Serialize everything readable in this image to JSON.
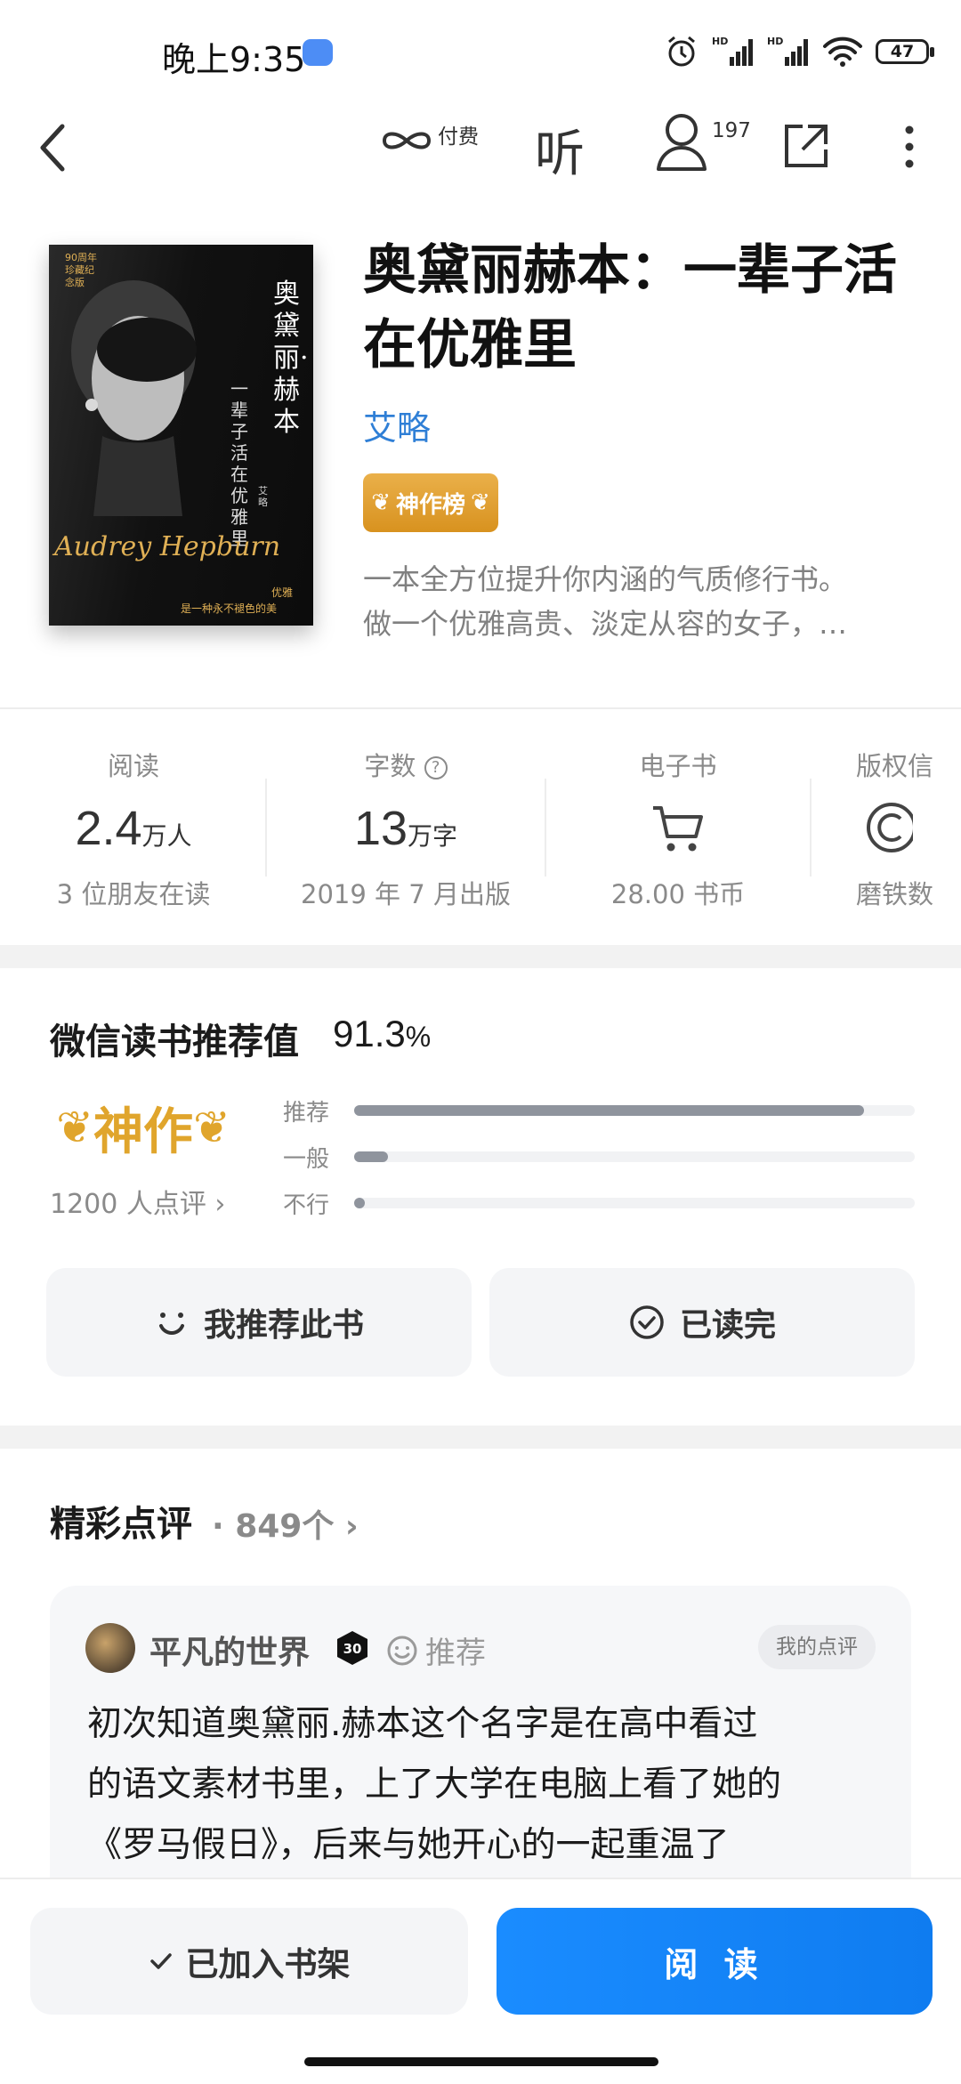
{
  "status": {
    "time": "晚上9:35",
    "battery": "47"
  },
  "topbar": {
    "paid_label": "付费",
    "listen_label": "听",
    "user_count": "197"
  },
  "book": {
    "title": "奥黛丽赫本：一辈子活在优雅里",
    "author": "艾略",
    "badge": "神作榜",
    "desc_lines": [
      "一本全方位提升你内涵的气质修行书。",
      "做一个优雅高贵、淡定从容的女子，…"
    ],
    "cover": {
      "vert_title": "奥黛丽·赫本",
      "vert_sub": "一辈子活在优雅里",
      "edition": "90周年珍藏纪念版",
      "author_small": "艾略",
      "signature": "Audrey Hepburn",
      "tagline1": "优雅",
      "tagline2": "是一种永不褪色的美"
    }
  },
  "stats": [
    {
      "label": "阅读",
      "value": "2.4",
      "unit": "万人",
      "sub": "3 位朋友在读"
    },
    {
      "label": "字数",
      "value": "13",
      "unit": "万字",
      "sub": "2019 年 7 月出版"
    },
    {
      "label": "电子书",
      "sub": "28.00 书币",
      "icon": "cart-icon"
    },
    {
      "label": "版权信",
      "sub": "磨铁数",
      "icon": "copyright-icon"
    }
  ],
  "recommend": {
    "title": "微信读书推荐值",
    "value": "91.3",
    "pct": "%",
    "rating_word": "神作",
    "review_count": "1200 人点评",
    "bars": [
      {
        "label": "推荐",
        "fraction": 0.91
      },
      {
        "label": "一般",
        "fraction": 0.06
      },
      {
        "label": "不行",
        "fraction": 0.02
      }
    ],
    "btn_recommend": "我推荐此书",
    "btn_finished": "已读完"
  },
  "reviews": {
    "heading": "精彩点评",
    "count": "· 849个",
    "item": {
      "user": "平凡的世界",
      "level": "30",
      "tag": "推荐",
      "mine": "我的点评",
      "text_lines": [
        "初次知道奥黛丽.赫本这个名字是在高中看过",
        "的语文素材书里，上了大学在电脑上看了她的",
        "《罗马假日》，后来与她开心的一起重温了"
      ]
    }
  },
  "bottom": {
    "shelf_label": "已加入书架",
    "read_label": "阅 读"
  }
}
